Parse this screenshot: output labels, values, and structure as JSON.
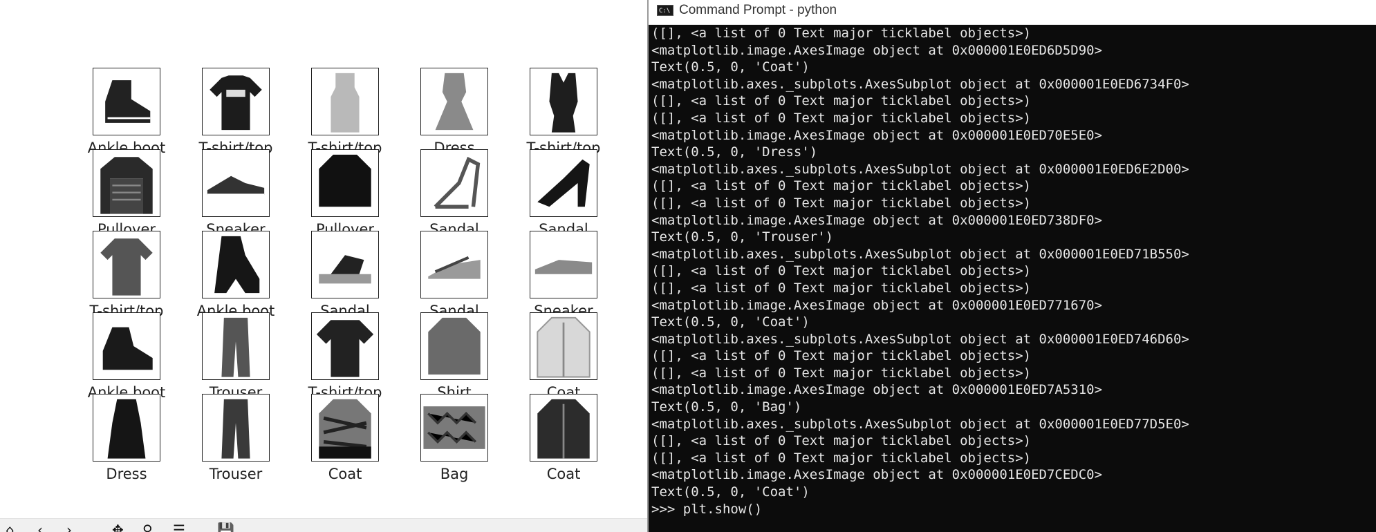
{
  "figure": {
    "row_labels": [
      [
        "Ankle boot",
        "T-shirt/top",
        "T-shirt/top",
        "Dress",
        "T-shirt/top"
      ],
      [
        "Pullover",
        "Sneaker",
        "Pullover",
        "Sandal",
        "Sandal"
      ],
      [
        "T-shirt/top",
        "Ankle boot",
        "Sandal",
        "Sandal",
        "Sneaker"
      ],
      [
        "Ankle boot",
        "Trouser",
        "T-shirt/top",
        "Shirt",
        "Coat"
      ],
      [
        "Dress",
        "Trouser",
        "Coat",
        "Bag",
        "Coat"
      ]
    ]
  },
  "toolbar": {
    "home_glyph": "⌂",
    "back_glyph": "‹",
    "forward_glyph": "›",
    "pan_glyph": "✥",
    "zoom_glyph": "⚲",
    "configure_glyph": "☰",
    "save_glyph": "💾"
  },
  "cmd": {
    "title": "Command Prompt - python",
    "icon_text": "C:\\",
    "lines": [
      "([], <a list of 0 Text major ticklabel objects>)",
      "<matplotlib.image.AxesImage object at 0x000001E0ED6D5D90>",
      "Text(0.5, 0, 'Coat')",
      "<matplotlib.axes._subplots.AxesSubplot object at 0x000001E0ED6734F0>",
      "([], <a list of 0 Text major ticklabel objects>)",
      "([], <a list of 0 Text major ticklabel objects>)",
      "<matplotlib.image.AxesImage object at 0x000001E0ED70E5E0>",
      "Text(0.5, 0, 'Dress')",
      "<matplotlib.axes._subplots.AxesSubplot object at 0x000001E0ED6E2D00>",
      "([], <a list of 0 Text major ticklabel objects>)",
      "([], <a list of 0 Text major ticklabel objects>)",
      "<matplotlib.image.AxesImage object at 0x000001E0ED738DF0>",
      "Text(0.5, 0, 'Trouser')",
      "<matplotlib.axes._subplots.AxesSubplot object at 0x000001E0ED71B550>",
      "([], <a list of 0 Text major ticklabel objects>)",
      "([], <a list of 0 Text major ticklabel objects>)",
      "<matplotlib.image.AxesImage object at 0x000001E0ED771670>",
      "Text(0.5, 0, 'Coat')",
      "<matplotlib.axes._subplots.AxesSubplot object at 0x000001E0ED746D60>",
      "([], <a list of 0 Text major ticklabel objects>)",
      "([], <a list of 0 Text major ticklabel objects>)",
      "<matplotlib.image.AxesImage object at 0x000001E0ED7A5310>",
      "Text(0.5, 0, 'Bag')",
      "<matplotlib.axes._subplots.AxesSubplot object at 0x000001E0ED77D5E0>",
      "([], <a list of 0 Text major ticklabel objects>)",
      "([], <a list of 0 Text major ticklabel objects>)",
      "<matplotlib.image.AxesImage object at 0x000001E0ED7CEDC0>",
      "Text(0.5, 0, 'Coat')",
      ">>> plt.show()"
    ]
  }
}
